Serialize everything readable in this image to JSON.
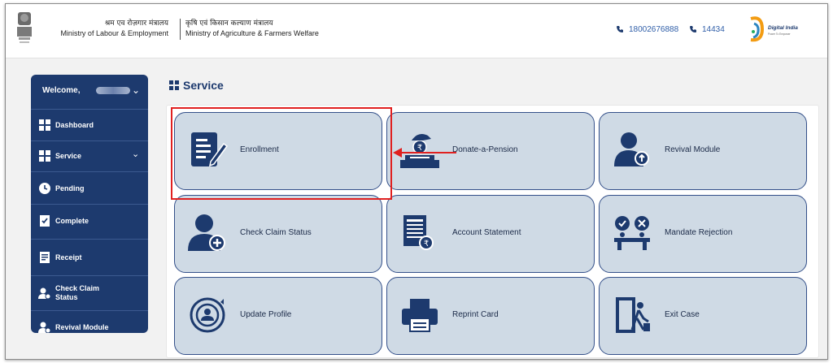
{
  "header": {
    "ministry_labour_hindi": "श्रम एव रोज़गार मंत्रालय",
    "ministry_labour_eng": "Ministry of Labour & Employment",
    "ministry_agri_hindi": "कृषि एवं किसान कल्याण मंत्रालय",
    "ministry_agri_eng": "Ministry of Agriculture & Farmers Welfare",
    "phone1": "18002676888",
    "phone2": "14434",
    "digital_india": "Digital India",
    "digital_india_tagline": "Power To Empower"
  },
  "sidebar": {
    "welcome": "Welcome, ",
    "items": [
      {
        "label": "Dashboard",
        "icon": "dashboard-icon"
      },
      {
        "label": "Service",
        "icon": "grid-icon",
        "expandable": true
      },
      {
        "label": "Pending",
        "icon": "clock-icon"
      },
      {
        "label": "Complete",
        "icon": "check-doc-icon"
      },
      {
        "label": "Receipt",
        "icon": "receipt-icon"
      },
      {
        "label": "Check Claim Status",
        "icon": "user-check-icon"
      },
      {
        "label": "Revival Module",
        "icon": "user-revival-icon"
      }
    ]
  },
  "main": {
    "title": "Service",
    "cards": [
      {
        "label": "Enrollment",
        "icon": "enrollment-icon"
      },
      {
        "label": "Donate-a-Pension",
        "icon": "donate-icon"
      },
      {
        "label": "Revival Module",
        "icon": "revival-icon"
      },
      {
        "label": "Check Claim Status",
        "icon": "claim-status-icon"
      },
      {
        "label": "Account Statement",
        "icon": "account-statement-icon"
      },
      {
        "label": "Mandate Rejection",
        "icon": "mandate-rejection-icon"
      },
      {
        "label": "Update Profile",
        "icon": "update-profile-icon"
      },
      {
        "label": "Reprint Card",
        "icon": "printer-icon"
      },
      {
        "label": "Exit Case",
        "icon": "exit-icon"
      }
    ]
  },
  "colors": {
    "sidebar_bg": "#1d3a6e",
    "card_bg": "#cfdae5",
    "card_border": "#34508a",
    "highlight": "#e02020",
    "link": "#2f5ea8"
  }
}
